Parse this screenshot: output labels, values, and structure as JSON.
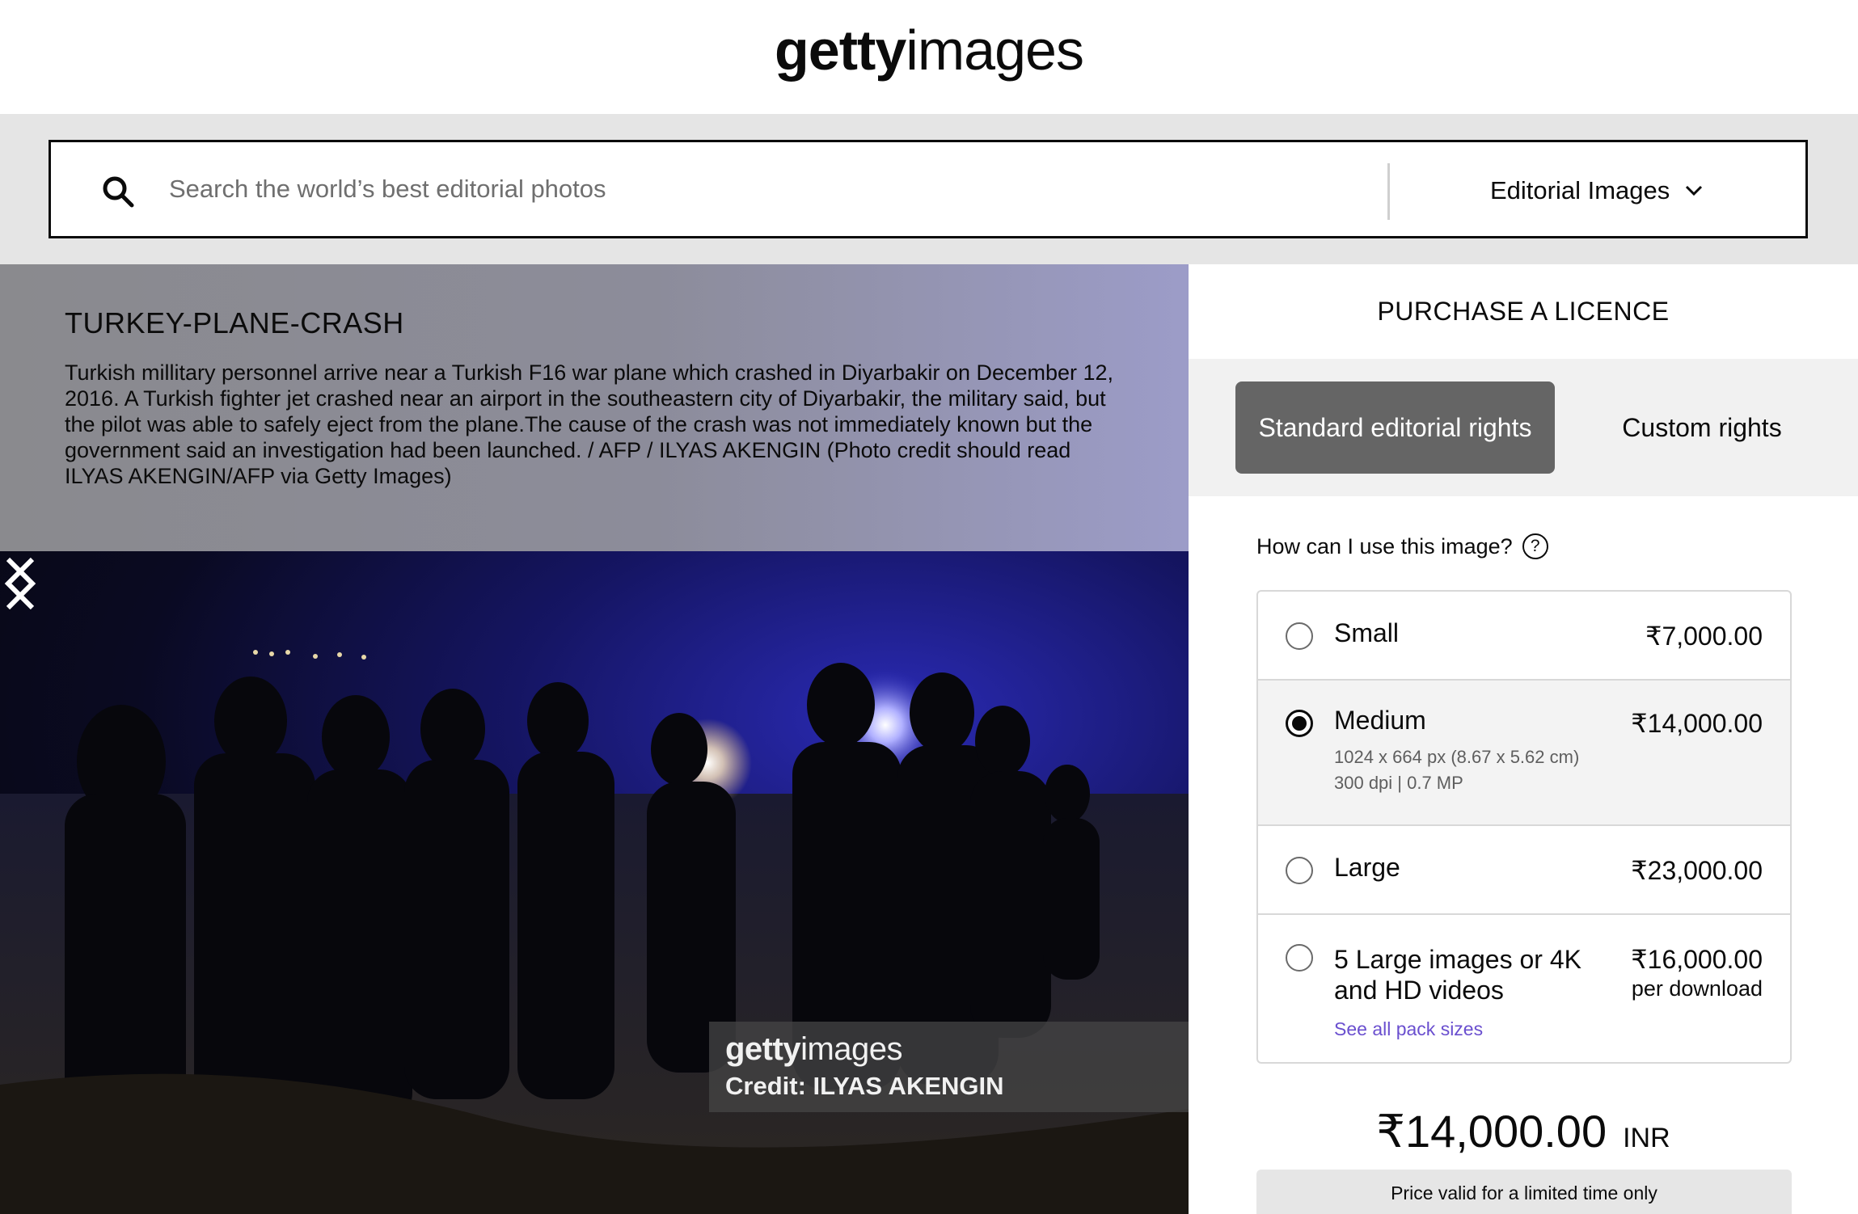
{
  "header": {
    "logo_bold": "getty",
    "logo_light": "images"
  },
  "search": {
    "placeholder": "Search the world’s best editorial photos",
    "type_label": "Editorial Images"
  },
  "image": {
    "title": "TURKEY-PLANE-CRASH",
    "caption": "Turkish millitary personnel arrive near a Turkish F16 war plane which crashed in Diyarbakir on December 12, 2016. A Turkish fighter jet crashed near an airport in the southeastern city of Diyarbakir, the military said, but the pilot was able to safely eject from the plane.The cause of the crash was not immediately known but the government said an investigation had been launched. / AFP / ILYAS AKENGIN (Photo credit should read ILYAS AKENGIN/AFP via Getty Images)",
    "watermark_bold": "getty",
    "watermark_light": "images",
    "credit": "Credit: ILYAS AKENGIN"
  },
  "licence": {
    "title": "PURCHASE A LICENCE",
    "tab_standard": "Standard editorial rights",
    "tab_custom": "Custom rights",
    "question": "How can I use this image?",
    "help": "?",
    "options": [
      {
        "label": "Small",
        "price": "₹7,000.00",
        "selected": false
      },
      {
        "label": "Medium",
        "price": "₹14,000.00",
        "selected": true,
        "detail1": "1024 x 664 px (8.67 x 5.62 cm)",
        "detail2": "300 dpi | 0.7 MP"
      },
      {
        "label": "Large",
        "price": "₹23,000.00",
        "selected": false
      },
      {
        "label": "5 Large images or 4K and HD videos",
        "price": "₹16,000.00",
        "per": "per download",
        "link": "See all pack sizes",
        "selected": false
      }
    ],
    "total_amount": "₹14,000.00",
    "total_currency": "INR",
    "validity": "Price valid for a limited time only"
  }
}
